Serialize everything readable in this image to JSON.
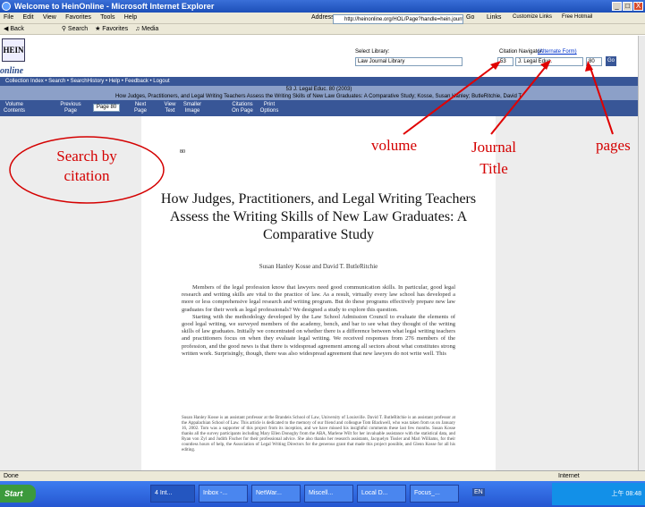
{
  "window": {
    "title": "Welcome to HeinOnline - Microsoft Internet Explorer",
    "controls": [
      "_",
      "□",
      "X"
    ]
  },
  "menu": [
    "File",
    "Edit",
    "View",
    "Favorites",
    "Tools",
    "Help"
  ],
  "toolbar": {
    "back": "Back",
    "search": "Search",
    "favorites": "Favorites",
    "media": "Media"
  },
  "address": {
    "label": "Address",
    "value": "http://heinonline.org/HOL/Page?handle=hein.journals/jled53&c",
    "go": "Go",
    "links": "Links",
    "links_items": [
      "Customize Links",
      "Free Hotmail"
    ]
  },
  "site": {
    "logo": "HEIN",
    "logo_text": "online",
    "select_library_label": "Select Library:",
    "library_value": "Law Journal Library",
    "citation_navigator_label": "Citation Navigator:",
    "alternate_form": "(Alternate Form)",
    "volume": "53",
    "journal": "J. Legal Educ.",
    "page": "80",
    "go": "Go"
  },
  "nav": [
    "Collection Index",
    "Search",
    "SearchHistory",
    "Help",
    "Feedback",
    "Logout"
  ],
  "citation": {
    "line1": "53 J. Legal Educ. 80 (2003)",
    "line2": "How Judges, Practitioners, and Legal Writing Teachers Assess the Writing Skills of New Law Graduates: A Comparative Study; Kosse, Susan Hanley; ButleRitchie, David T."
  },
  "pagebar": {
    "volume_contents": "Volume Contents",
    "previous_page": "Previous Page",
    "page_select": "Page 80",
    "next_page": "Next Page",
    "view_text": "View Text",
    "smaller_image": "Smaller Image",
    "citations_on_page": "Citations On Page",
    "print_options": "Print Options"
  },
  "article": {
    "page_number": "80",
    "title": "How Judges, Practitioners, and Legal Writing Teachers Assess the Writing Skills of New Law Graduates: A Comparative Study",
    "authors": "Susan Hanley Kosse and David T. ButleRitchie",
    "para1": "Members of the legal profession know that lawyers need good communication skills. In particular, good legal research and writing skills are vital to the practice of law. As a result, virtually every law school has developed a more or less comprehensive legal research and writing program. But do these programs effectively prepare new law graduates for their work as legal professionals? We designed a study to explore this question.",
    "para2": "Starting with the methodology developed by the Law School Admission Council to evaluate the elements of good legal writing, we surveyed members of the academy, bench, and bar to see what they thought of the writing skills of law graduates. Initially we concentrated on whether there is a difference between what legal writing teachers and practitioners focus on when they evaluate legal writing. We received responses from 276 members of the profession, and the good news is that there is widespread agreement among all sectors about what constitutes strong written work. Surprisingly, though, there was also widespread agreement that new lawyers do not write well. This",
    "footnote": "Susan Hanley Kosse is an assistant professor at the Brandeis School of Law, University of Louisville. David T. ButleRitchie is an assistant professor at the Appalachian School of Law. This article is dedicated to the memory of our friend and colleague Tom Blackwell, who was taken from us on January 16, 2002. Tom was a supporter of this project from its inception, and we have missed his insightful comments these last few months. Susan Kosse thanks all the survey participants including Mary Ellen Donoghy from the ABA, Marlene Wilt for her invaluable assistance with the statistical data, and Ryan von Zyl and Judith Fischer for their professional advice. She also thanks her research assistants, Jacquelyn Tissler and Mari Williams, for their countless hours of help, the Association of Legal Writing Directors for the generous grant that made this project possible, and Glenn Kosse for all his editing."
  },
  "annotations": {
    "search_by_citation": "Search by citation",
    "volume": "volume",
    "journal_title": "Journal Title",
    "pages": "pages"
  },
  "status": {
    "left": "Done",
    "zone": "Internet"
  },
  "taskbar": {
    "start": "Start",
    "tasks": [
      "4 Int...",
      "Inbox -...",
      "NetWar...",
      "Miscell...",
      "Local D...",
      "Focus_..."
    ],
    "lang": "EN",
    "clock": "上午 08:48"
  }
}
